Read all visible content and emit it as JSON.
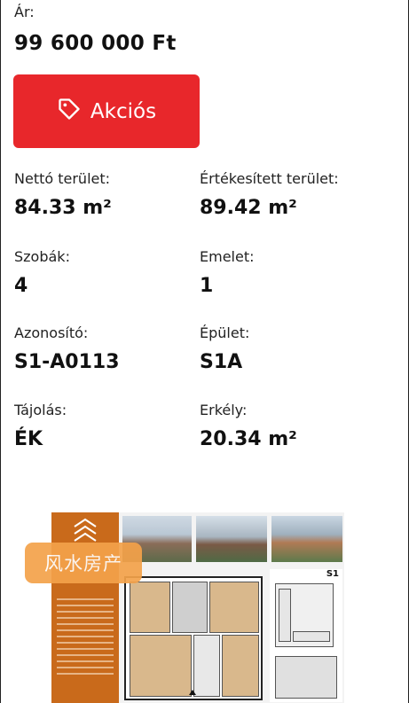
{
  "price": {
    "label": "Ár:",
    "value": "99 600 000 Ft"
  },
  "sale_button": {
    "label": "Akciós",
    "icon": "tag-icon",
    "color": "#e8272b"
  },
  "attributes": [
    {
      "label": "Nettó terület:",
      "value": "84.33 m²"
    },
    {
      "label": "Értékesített terület:",
      "value": "89.42 m²"
    },
    {
      "label": "Szobák:",
      "value": "4"
    },
    {
      "label": "Emelet:",
      "value": "1"
    },
    {
      "label": "Azonosító:",
      "value": "S1-A0113"
    },
    {
      "label": "Épület:",
      "value": "S1A"
    },
    {
      "label": "Tájolás:",
      "value": "ÉK"
    },
    {
      "label": "Erkély:",
      "value": "20.34 m²"
    }
  ],
  "floorplan": {
    "building_label": "S1",
    "accent": "#c96a1b"
  },
  "watermark": {
    "text": "风水房产",
    "color": "#f4a24a"
  }
}
